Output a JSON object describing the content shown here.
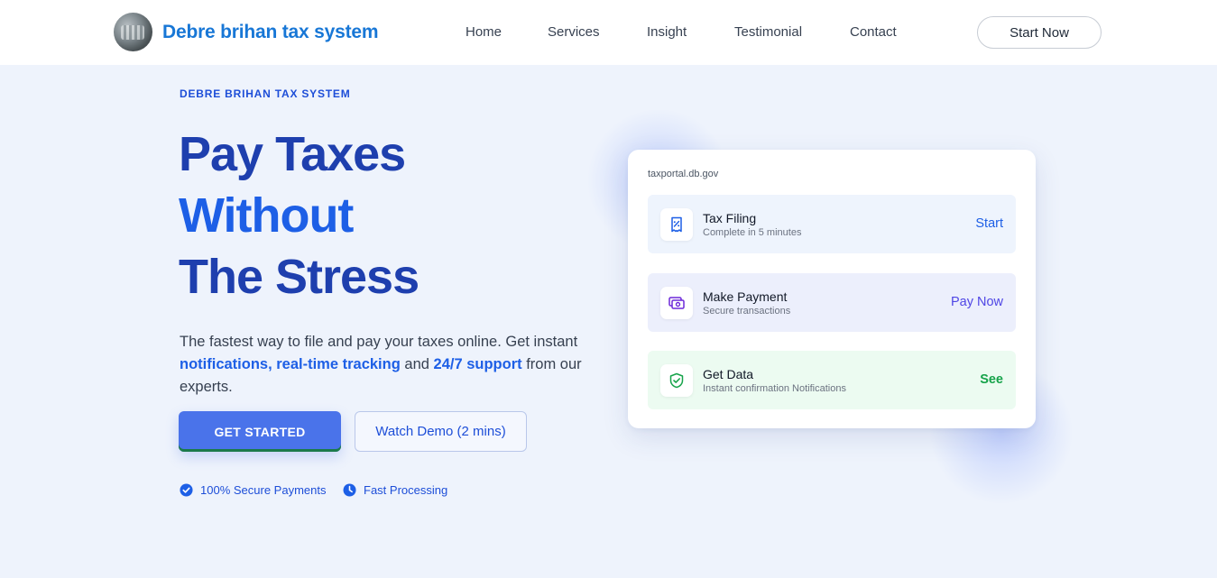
{
  "header": {
    "brand_name": "Debre brihan tax system",
    "nav": [
      "Home",
      "Services",
      "Insight",
      "Testimonial",
      "Contact"
    ],
    "cta": "Start Now"
  },
  "hero": {
    "eyebrow": "DEBRE BRIHAN TAX SYSTEM",
    "headline": [
      "Pay Taxes",
      "Without",
      "The Stress"
    ],
    "lead_part1": "The fastest way to file and pay your taxes online. Get instant ",
    "lead_hl1": "notifications, real-time tracking",
    "lead_part2": " and ",
    "lead_hl2": "24/7 support",
    "lead_part3": " from our experts.",
    "primary_button": "GET STARTED",
    "secondary_button": "Watch Demo (2 mins)",
    "features": [
      "100% Secure Payments",
      "Fast Processing"
    ]
  },
  "card": {
    "url": "taxportal.db.gov",
    "rows": [
      {
        "title": "Tax Filing",
        "subtitle": "Complete in 5 minutes",
        "action": "Start",
        "icon": "receipt-icon"
      },
      {
        "title": "Make Payment",
        "subtitle": "Secure transactions",
        "action": "Pay Now",
        "icon": "money-icon"
      },
      {
        "title": "Get Data",
        "subtitle": "Instant confirmation Notifications",
        "action": "See",
        "icon": "shield-check-icon"
      }
    ]
  },
  "colors": {
    "accent": "#1d5fe6",
    "brand": "#1877d6",
    "heading": "#1e3fae",
    "success": "#16a34a",
    "background": "#eef3fc"
  }
}
